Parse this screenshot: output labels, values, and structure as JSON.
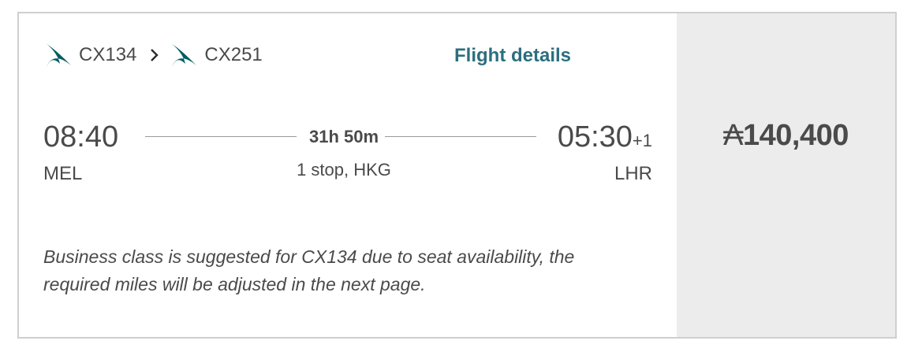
{
  "flights": [
    {
      "number": "CX134",
      "logo": "cathay-pacific-logo"
    },
    {
      "number": "CX251",
      "logo": "cathay-pacific-logo"
    }
  ],
  "separator_icon": "chevron-right-icon",
  "flight_details_label": "Flight details",
  "departure": {
    "time": "08:40",
    "airport": "MEL"
  },
  "arrival": {
    "time": "05:30",
    "day_offset": "+1",
    "airport": "LHR"
  },
  "duration": "31h 50m",
  "stops": "1 stop, HKG",
  "note": "Business class is suggested for CX134 due to seat availability, the required miles will be adjusted in the next page.",
  "price": {
    "currency_icon": "asia-miles-icon",
    "currency_symbol": "₳",
    "amount": "140,400"
  },
  "colors": {
    "brand": "#005d63",
    "link": "#2c6e7f",
    "text": "#4a4a4a",
    "price_panel": "#ececec"
  }
}
